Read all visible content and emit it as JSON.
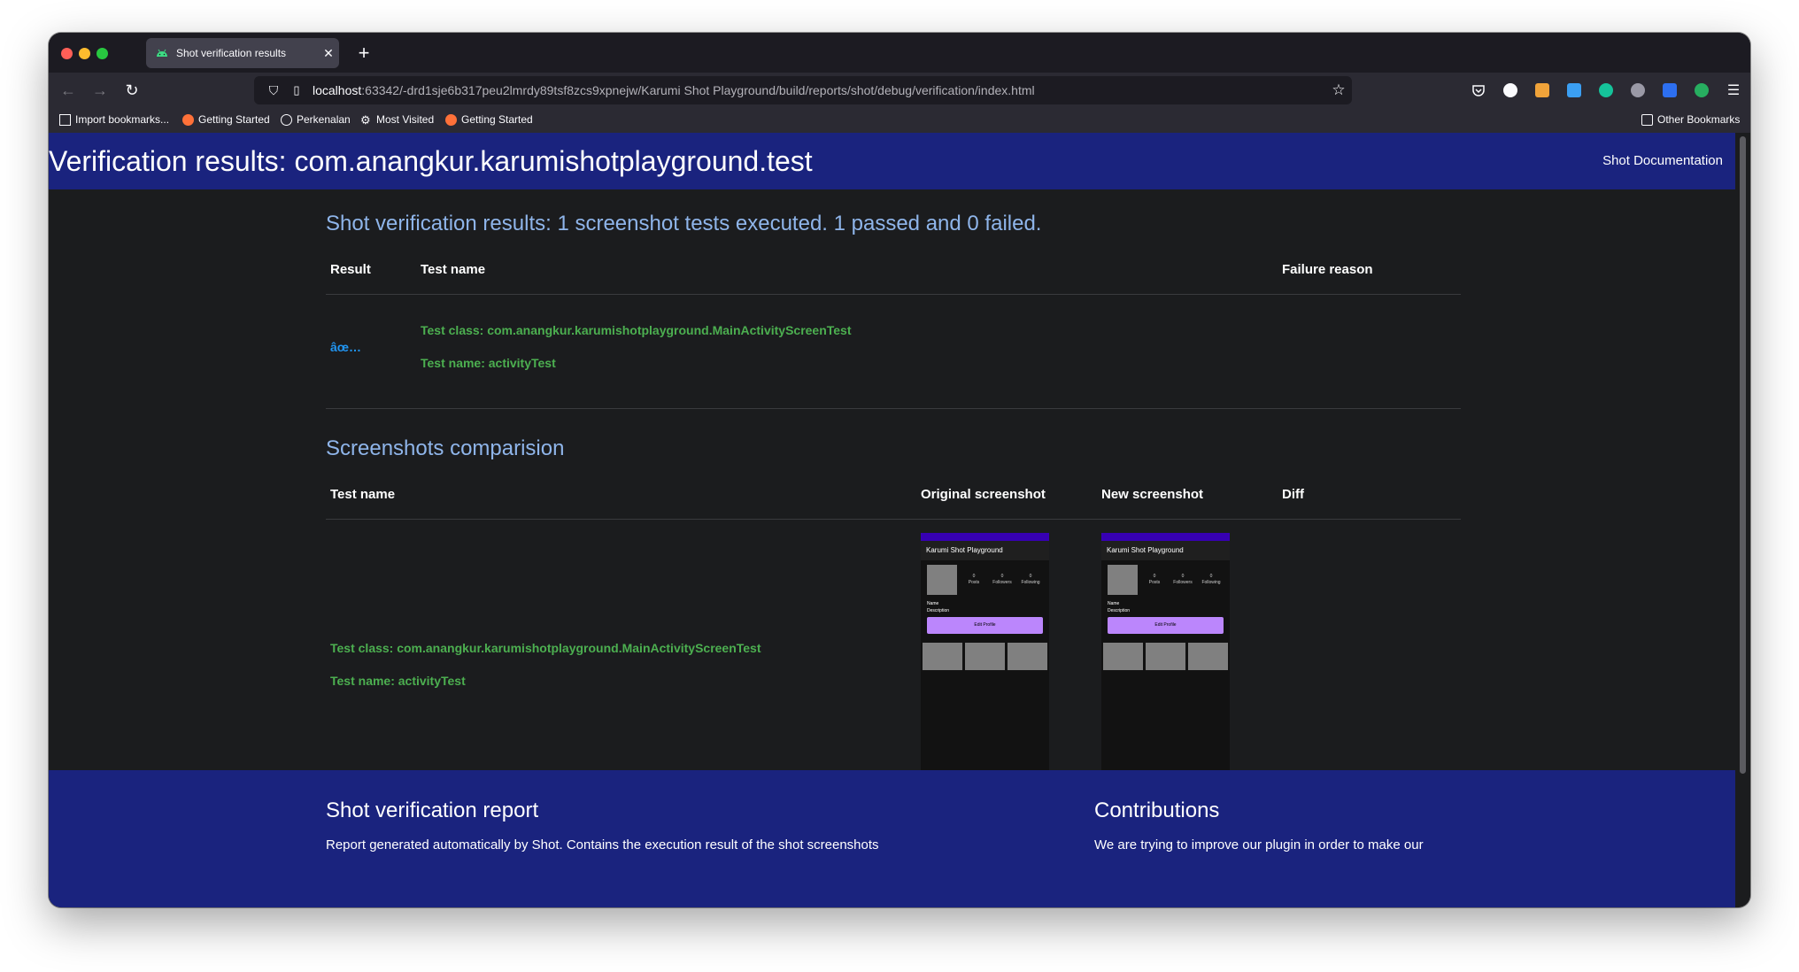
{
  "browser": {
    "tab_title": "Shot verification results",
    "url_host": "localhost",
    "url_rest": ":63342/-drd1sje6b317peu2lmrdy89tsf8zcs9xpnejw/Karumi Shot Playground/build/reports/shot/debug/verification/index.html",
    "bookmarks": [
      {
        "label": "Import bookmarks...",
        "icon": "import-icon"
      },
      {
        "label": "Getting Started",
        "icon": "firefox-icon"
      },
      {
        "label": "Perkenalan",
        "icon": "globe-icon"
      },
      {
        "label": "Most Visited",
        "icon": "gear-icon"
      },
      {
        "label": "Getting Started",
        "icon": "firefox-icon"
      }
    ],
    "other_bookmarks": "Other Bookmarks"
  },
  "page": {
    "title": "Verification results: com.anangkur.karumishotplayground.test",
    "doc_link": "Shot Documentation",
    "summary": "Shot verification results: 1 screenshot tests executed. 1 passed and 0 failed.",
    "results_table": {
      "headers": {
        "result": "Result",
        "test_name": "Test name",
        "failure_reason": "Failure reason"
      },
      "row": {
        "result_icon": "âœ…",
        "test_class": "Test class: com.anangkur.karumishotplayground.MainActivityScreenTest",
        "test_name": "Test name: activityTest",
        "failure_reason": ""
      }
    },
    "comparison_title": "Screenshots comparision",
    "comparison_table": {
      "headers": {
        "test_name": "Test name",
        "original": "Original screenshot",
        "new": "New screenshot",
        "diff": "Diff"
      },
      "row": {
        "test_class": "Test class: com.anangkur.karumishotplayground.MainActivityScreenTest",
        "test_name": "Test name: activityTest"
      }
    },
    "phone": {
      "app_title": "Karumi Shot Playground",
      "stats": [
        {
          "value": "0",
          "label": "Posts"
        },
        {
          "value": "0",
          "label": "Followers"
        },
        {
          "value": "0",
          "label": "Following"
        }
      ],
      "name": "Name",
      "description": "Description",
      "button": "Edit Profile"
    },
    "footer": {
      "report_title": "Shot verification report",
      "report_text": "Report generated automatically by Shot. Contains the execution result of the shot screenshots",
      "contrib_title": "Contributions",
      "contrib_text": "We are trying to improve our plugin in order to make our"
    }
  },
  "colors": {
    "header": "#1a237e",
    "pass_green": "#4caf50",
    "accent_blue": "#8fb5ea",
    "phone_button": "#bb86fc"
  }
}
